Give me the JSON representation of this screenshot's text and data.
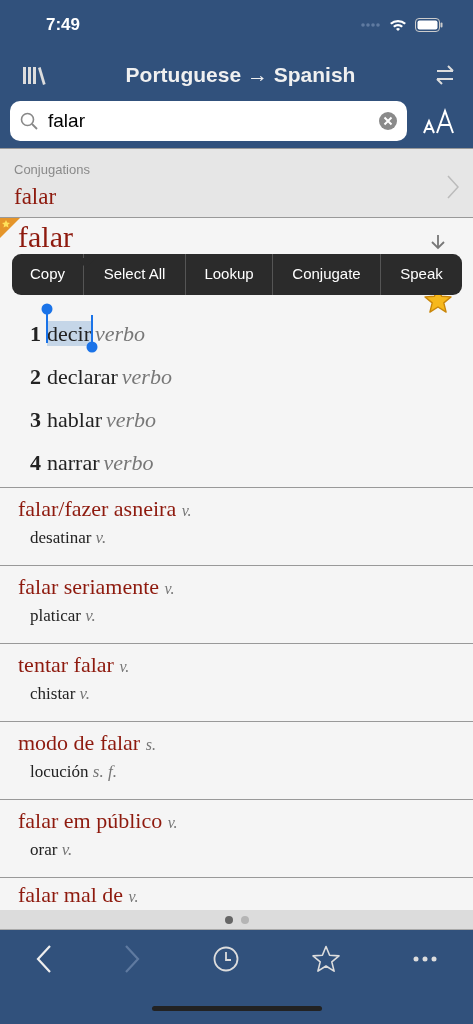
{
  "status_bar": {
    "time": "7:49"
  },
  "nav": {
    "title": "Portuguese → Spanish"
  },
  "search": {
    "value": "falar"
  },
  "conjugations": {
    "label": "Conjugations",
    "word": "falar"
  },
  "entry": {
    "headword": "falar",
    "favorite": true,
    "senses": [
      {
        "number": "1",
        "word": "decir",
        "pos": "verbo",
        "selected": true
      },
      {
        "number": "2",
        "word": "declarar",
        "pos": "verbo",
        "selected": false
      },
      {
        "number": "3",
        "word": "hablar",
        "pos": "verbo",
        "selected": false
      },
      {
        "number": "4",
        "word": "narrar",
        "pos": "verbo",
        "selected": false
      }
    ]
  },
  "context_menu": [
    "Copy",
    "Select All",
    "Lookup",
    "Conjugate",
    "Speak"
  ],
  "results": [
    {
      "term": "falar/fazer asneira",
      "pos": "v.",
      "translation": "desatinar",
      "translation_pos": "v."
    },
    {
      "term": "falar seriamente",
      "pos": "v.",
      "translation": "platicar",
      "translation_pos": "v."
    },
    {
      "term": "tentar falar",
      "pos": "v.",
      "translation": "chistar",
      "translation_pos": "v."
    },
    {
      "term": "modo de falar",
      "pos": "s.",
      "translation": "locución",
      "translation_pos": "s. f."
    },
    {
      "term": "falar em público",
      "pos": "v.",
      "translation": "orar",
      "translation_pos": "v."
    },
    {
      "term": "falar mal de",
      "pos": "v."
    }
  ],
  "pager": [
    {
      "selected": true
    },
    {
      "selected": false
    }
  ],
  "toolbar": {
    "back_disabled": false,
    "forward_disabled": true
  }
}
